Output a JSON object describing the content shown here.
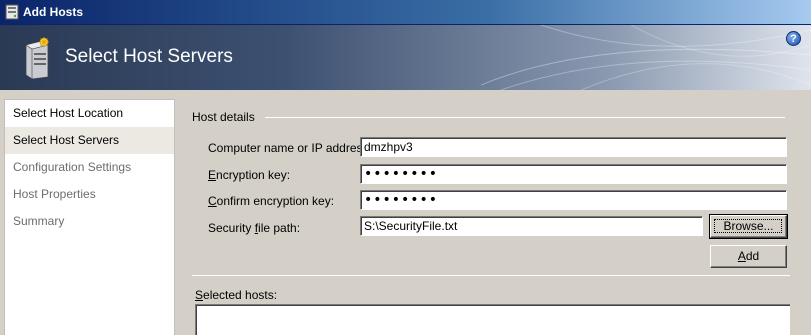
{
  "window": {
    "title": "Add Hosts"
  },
  "banner": {
    "heading": "Select Host Servers",
    "help_glyph": "?"
  },
  "nav": {
    "items": [
      {
        "label": "Select Host Location",
        "state": "normal"
      },
      {
        "label": "Select Host Servers",
        "state": "active"
      },
      {
        "label": "Configuration Settings",
        "state": "disabled"
      },
      {
        "label": "Host Properties",
        "state": "disabled"
      },
      {
        "label": "Summary",
        "state": "disabled"
      }
    ]
  },
  "host_details": {
    "group_label": "Host details",
    "computer_name": {
      "label": "Computer name or IP address:",
      "value": "dmzhpv3"
    },
    "encryption_key": {
      "label_access": "E",
      "label_rest": "ncryption key:",
      "value": "••••••••"
    },
    "confirm_key": {
      "label_access": "C",
      "label_rest": "onfirm encryption key:",
      "value": "••••••••"
    },
    "security_file": {
      "label_pre": "Security ",
      "label_access": "f",
      "label_rest": "ile path:",
      "value": "S:\\SecurityFile.txt"
    },
    "browse_label": "Browse...",
    "add_label_access": "A",
    "add_label_rest": "dd"
  },
  "selected_hosts": {
    "label_access": "S",
    "label_rest": "elected hosts:"
  },
  "icons": {
    "app": "server-window-icon",
    "banner": "host-server-icon",
    "help": "help-icon"
  }
}
